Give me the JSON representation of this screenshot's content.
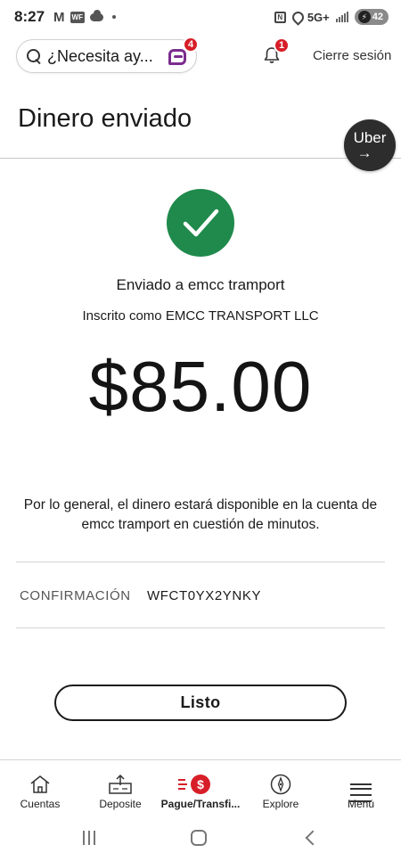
{
  "status_bar": {
    "time": "8:27",
    "network": "5G+",
    "battery": "42"
  },
  "header": {
    "search_text": "¿Necesita ay...",
    "fargo_badge_count": "4",
    "notification_count": "1",
    "logout_label": "Cierre sesión"
  },
  "page": {
    "title": "Dinero enviado"
  },
  "uber": {
    "label": "Uber",
    "arrow": "→"
  },
  "confirmation_screen": {
    "sent_to": "Enviado a emcc tramport",
    "registered_as": "Inscrito como EMCC TRANSPORT LLC",
    "amount": "$85.00",
    "availability_note": "Por lo general, el dinero estará disponible en la cuenta de emcc tramport en cuestión de minutos.",
    "confirmation_label": "CONFIRMACIÓN",
    "confirmation_number": "WFCT0YX2YNKY",
    "done_label": "Listo"
  },
  "tabs": [
    {
      "label": "Cuentas",
      "icon": "home-icon"
    },
    {
      "label": "Deposite",
      "icon": "deposit-icon"
    },
    {
      "label": "Pague/Transfi...",
      "icon": "pay-transfer-icon",
      "active": true
    },
    {
      "label": "Explore",
      "icon": "compass-icon"
    },
    {
      "label": "Menú",
      "icon": "menu-icon"
    }
  ],
  "colors": {
    "brand_red": "#d71e28",
    "success_green": "#1f8a4c",
    "fargo_purple": "#7b2d8e"
  }
}
